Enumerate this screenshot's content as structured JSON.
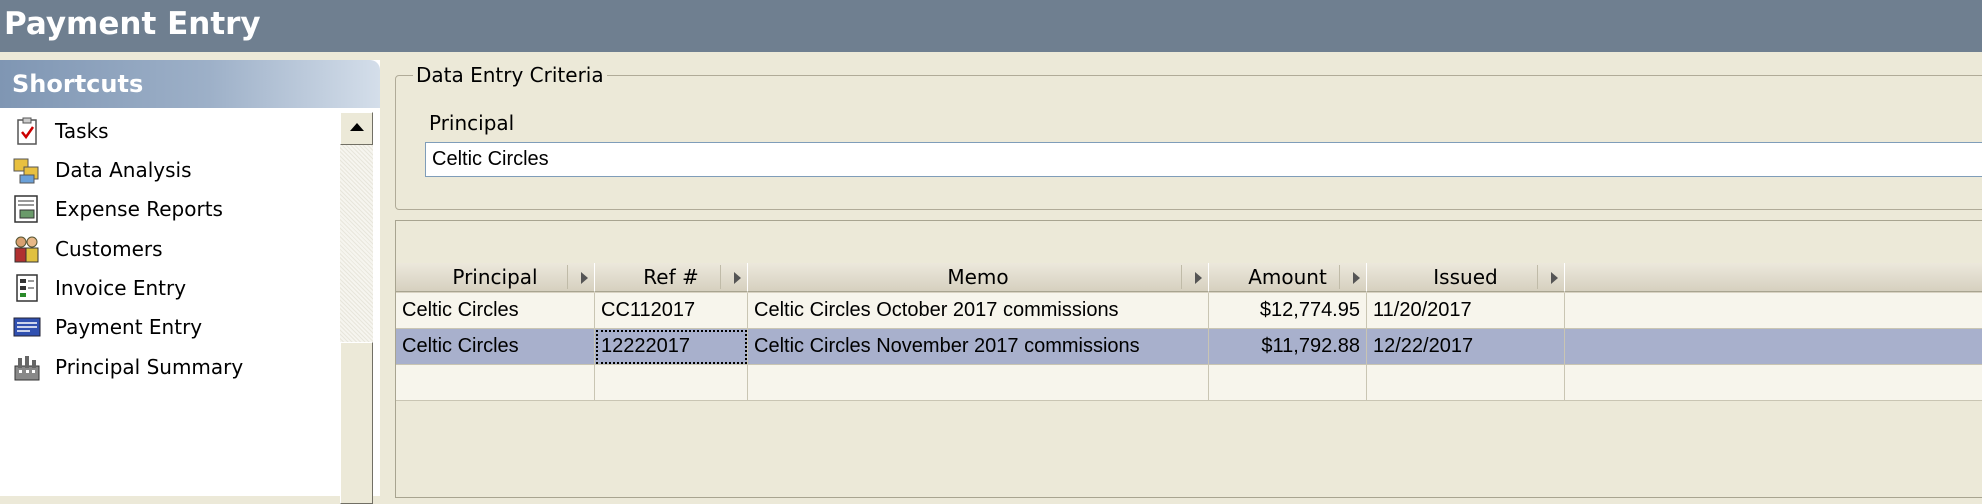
{
  "window": {
    "title": "Payment Entry"
  },
  "shortcuts": {
    "header": "Shortcuts",
    "items": [
      {
        "label": "Tasks",
        "icon": "tasks-clipboard-icon"
      },
      {
        "label": "Data Analysis",
        "icon": "data-analysis-icon"
      },
      {
        "label": "Expense Reports",
        "icon": "expense-reports-icon"
      },
      {
        "label": "Customers",
        "icon": "customers-icon"
      },
      {
        "label": "Invoice Entry",
        "icon": "invoice-entry-icon"
      },
      {
        "label": "Payment Entry",
        "icon": "payment-entry-icon"
      },
      {
        "label": "Principal Summary",
        "icon": "principal-summary-icon"
      }
    ]
  },
  "criteria": {
    "legend": "Data Entry Criteria",
    "principal_label": "Principal",
    "principal_value": "Celtic Circles"
  },
  "grid": {
    "columns": [
      {
        "label": "Principal"
      },
      {
        "label": "Ref #"
      },
      {
        "label": "Memo"
      },
      {
        "label": "Amount"
      },
      {
        "label": "Issued"
      }
    ],
    "rows": [
      {
        "principal": "Celtic Circles",
        "ref": "CC112017",
        "memo": "Celtic Circles October 2017 commissions",
        "amount": "$12,774.95",
        "issued": "11/20/2017",
        "selected": false
      },
      {
        "principal": "Celtic Circles",
        "ref": "12222017",
        "memo": "Celtic Circles November 2017 commissions",
        "amount": "$11,792.88",
        "issued": "12/22/2017",
        "selected": true
      }
    ]
  },
  "colors": {
    "title_bar": "#6f7f90",
    "selected_row": "#a8b0cc",
    "panel_bg": "#ece9d8"
  }
}
